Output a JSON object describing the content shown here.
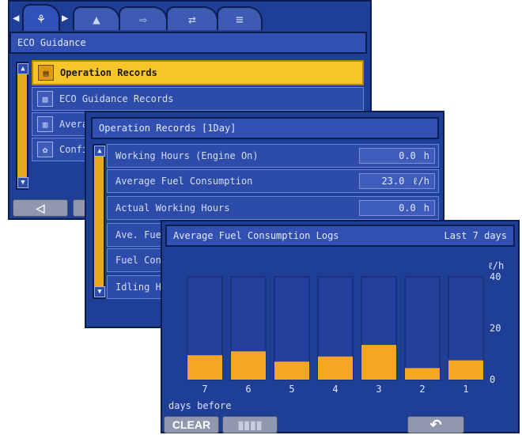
{
  "panel1": {
    "title": "ECO Guidance",
    "tabs": [
      {
        "icon": "leaf-icon",
        "glyph": "⚘"
      },
      {
        "icon": "work-machine-icon",
        "glyph": "▲"
      },
      {
        "icon": "arrow-right-icon",
        "glyph": "⇨"
      },
      {
        "icon": "swap-arrows-icon",
        "glyph": "⇄"
      },
      {
        "icon": "list-icon",
        "glyph": "≡"
      }
    ],
    "items": [
      {
        "label": "Operation Records",
        "glyph": "▤",
        "selected": true
      },
      {
        "label": "ECO Guidance Records",
        "glyph": "▧",
        "selected": false
      },
      {
        "label": "Avera",
        "glyph": "▥",
        "selected": false
      },
      {
        "label": "Confi",
        "glyph": "✿",
        "selected": false
      }
    ],
    "back_glyph": "◁"
  },
  "panel2": {
    "title": "Operation Records  [1Day]",
    "rows": [
      {
        "label": "Working Hours (Engine On)",
        "value": "0.0",
        "unit": "h"
      },
      {
        "label": "Average Fuel Consumption",
        "value": "23.0",
        "unit": "ℓ/h"
      },
      {
        "label": "Actual Working Hours",
        "value": "0.0",
        "unit": "h"
      },
      {
        "label": "Ave. Fue",
        "value": "",
        "unit": ""
      },
      {
        "label": "Fuel Con",
        "value": "",
        "unit": ""
      },
      {
        "label": "Idling H",
        "value": "",
        "unit": ""
      }
    ]
  },
  "panel3": {
    "title": "Average Fuel Consumption Logs",
    "period": "Last 7 days",
    "footer_note": "days before",
    "clear_label": "CLEAR",
    "chart_icon": "bar-chart-icon",
    "return_icon": "return-arrow-icon",
    "return_glyph": "↶"
  },
  "colors": {
    "accent": "#f8c528",
    "bar_fill": "#f5a623",
    "bar_bg": "#24409c",
    "panel_bg": "#1f3f97"
  },
  "chart_data": {
    "type": "bar",
    "categories": [
      "7",
      "6",
      "5",
      "4",
      "3",
      "2",
      "1"
    ],
    "values": [
      9.5,
      11,
      7,
      9,
      13.5,
      4.5,
      7.5
    ],
    "ylabel": "ℓ/h",
    "ylim": [
      0,
      40
    ],
    "yticks": [
      "0",
      "20",
      "40"
    ],
    "xlabel": "days before"
  }
}
